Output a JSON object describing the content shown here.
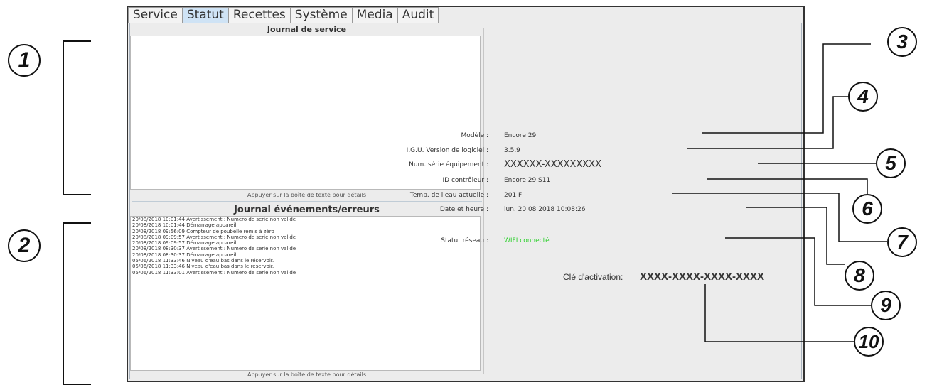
{
  "tabs": [
    "Service",
    "Statut",
    "Recettes",
    "Système",
    "Media",
    "Audit"
  ],
  "active_tab": "Statut",
  "service_log": {
    "title": "Journal de service",
    "hint": "Appuyer sur la boîte de texte pour détails",
    "entries": []
  },
  "event_log": {
    "title": "Journal événements/erreurs",
    "hint": "Appuyer sur la boîte de texte pour détails",
    "entries": [
      "20/08/2018 10:01:44 Avertissement : Numero de serie non valide",
      "20/08/2018 10:01:44 Démarrage appareil",
      "20/08/2018 09:56:09 Compteur de poubelle remis à zéro",
      "20/08/2018 09:09:57 Avertissement : Numero de serie non valide",
      "20/08/2018 09:09:57 Démarrage appareil",
      "20/08/2018 08:30:37 Avertissement : Numero de serie non valide",
      "20/08/2018 08:30:37 Démarrage appareil",
      "05/06/2018 11:33:46 Niveau d'eau bas dans le réservoir.",
      "05/06/2018 11:33:46 Niveau d'eau bas dans le réservoir.",
      "05/06/2018 11:33:01 Avertissement : Numero de serie non valide"
    ]
  },
  "status": {
    "model_label": "Modèle :",
    "model_value": "Encore 29",
    "software_label": "I.G.U. Version de logiciel :",
    "software_value": "3.5.9",
    "serial_label": "Num. série équipement :",
    "serial_value": "XXXXXX-XXXXXXXXX",
    "controller_label": "ID contrôleur :",
    "controller_value": "Encore 29  S11",
    "water_temp_label": "Temp. de l'eau actuelle :",
    "water_temp_value": "201 F",
    "datetime_label": "Date et heure :",
    "datetime_value": "lun. 20 08 2018 10:08:26",
    "network_label": "Statut réseau :",
    "network_value": "WIFI connecté",
    "activation_label": "Clé d'activation:",
    "activation_value": "XXXX-XXXX-XXXX-XXXX"
  },
  "callouts": [
    "1",
    "2",
    "3",
    "4",
    "5",
    "6",
    "7",
    "8",
    "9",
    "10"
  ],
  "colors": {
    "network_ok": "#2fd12f",
    "active_tab": "#cfe3f5"
  }
}
